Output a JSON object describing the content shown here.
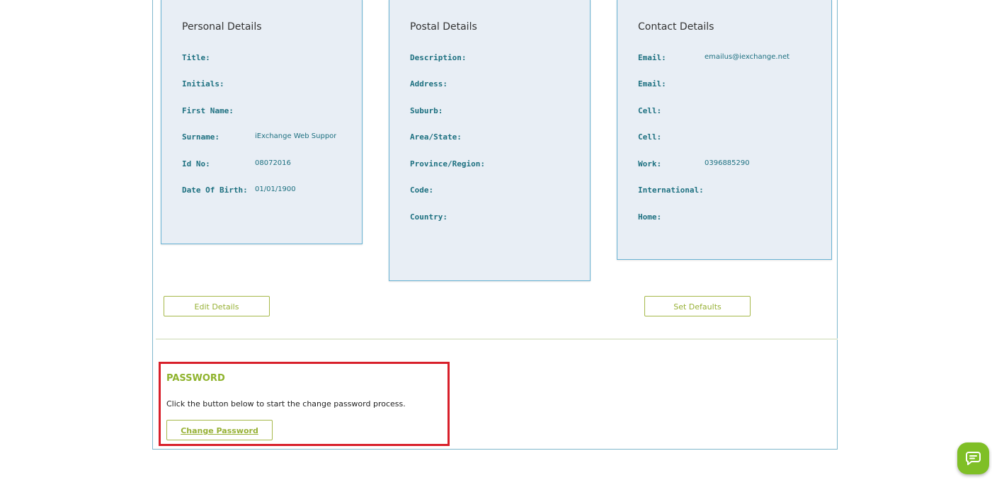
{
  "personal": {
    "title": "Personal Details",
    "rows": [
      {
        "label": "Title:",
        "value": ""
      },
      {
        "label": "Initials:",
        "value": ""
      },
      {
        "label": "First Name:",
        "value": ""
      },
      {
        "label": "Surname:",
        "value": "iExchange Web Support"
      },
      {
        "label": "Id No:",
        "value": "08072016"
      },
      {
        "label": "Date Of Birth:",
        "value": "01/01/1900"
      }
    ]
  },
  "postal": {
    "title": "Postal Details",
    "rows": [
      {
        "label": "Description:",
        "value": ""
      },
      {
        "label": "Address:",
        "value": ""
      },
      {
        "label": "Suburb:",
        "value": ""
      },
      {
        "label": "Area/State:",
        "value": ""
      },
      {
        "label": "Province/Region:",
        "value": ""
      },
      {
        "label": "Code:",
        "value": ""
      },
      {
        "label": "Country:",
        "value": ""
      }
    ]
  },
  "contact": {
    "title": "Contact Details",
    "rows": [
      {
        "label": "Email:",
        "value": "emailus@iexchange.net"
      },
      {
        "label": "Email:",
        "value": ""
      },
      {
        "label": "Cell:",
        "value": ""
      },
      {
        "label": "Cell:",
        "value": ""
      },
      {
        "label": "Work:",
        "value": "0396885290"
      },
      {
        "label": "International:",
        "value": ""
      },
      {
        "label": "Home:",
        "value": ""
      }
    ]
  },
  "actions": {
    "edit_label": "Edit Details",
    "defaults_label": "Set Defaults"
  },
  "password": {
    "heading": "PASSWORD",
    "description": "Click the button below to start the change password process.",
    "button_label": "Change Password"
  },
  "chat": {
    "icon": "chat-bubble-icon"
  },
  "colors": {
    "card_bg": "#e8eef5",
    "card_border": "#69b3d4",
    "label_teal": "#1d7080",
    "accent_green": "#97b136",
    "highlight_red": "#d81f2a"
  }
}
